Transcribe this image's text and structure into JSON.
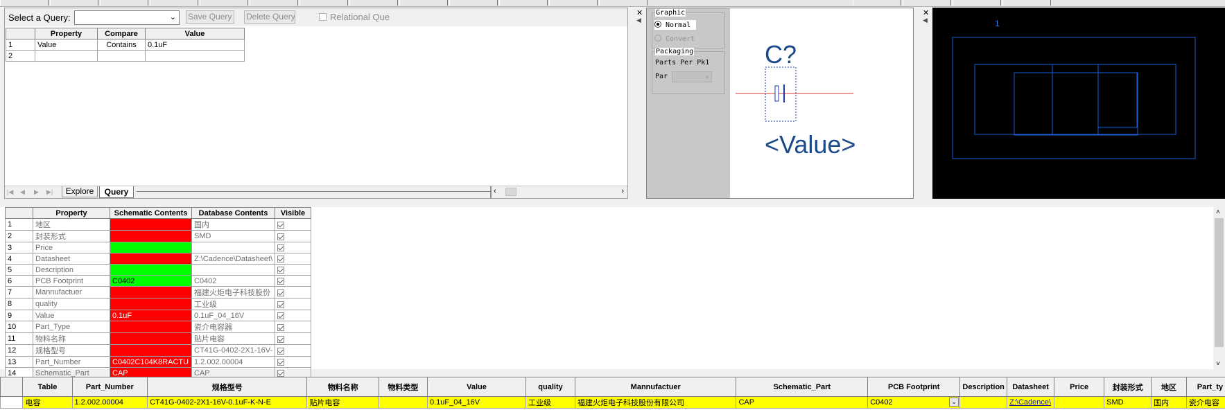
{
  "query": {
    "select_label": "Select a Query:",
    "select_value": "",
    "save_label": "Save Query",
    "delete_label": "Delete Query",
    "relational_label": "Relational Que",
    "headers": [
      "Property",
      "Compare",
      "Value"
    ],
    "rows": [
      {
        "num": "1",
        "property": "Value",
        "compare": "Contains",
        "value": "0.1uF"
      },
      {
        "num": "2",
        "property": "",
        "compare": "",
        "value": ""
      }
    ],
    "tabs": [
      "Explore",
      "Query"
    ]
  },
  "graphic": {
    "group_label": "Graphic",
    "normal_label": "Normal",
    "convert_label": "Convert",
    "packaging_label": "Packaging",
    "parts_per_pkg_label": "Parts Per Pk1",
    "part_label": "Par",
    "refdes": "C?",
    "value_text": "<Value>"
  },
  "footprint": {
    "pin_label": "1"
  },
  "compare": {
    "headers": [
      "Property",
      "Schematic Contents",
      "Database Contents",
      "Visible"
    ],
    "rows": [
      {
        "num": "1",
        "property": "地区",
        "sch": "",
        "sch_color": "red",
        "db": "国内"
      },
      {
        "num": "2",
        "property": "封装形式",
        "sch": "",
        "sch_color": "red",
        "db": "SMD"
      },
      {
        "num": "3",
        "property": "Price",
        "sch": "",
        "sch_color": "green",
        "db": ""
      },
      {
        "num": "4",
        "property": "Datasheet",
        "sch": "",
        "sch_color": "red",
        "db": "Z:\\Cadence\\Datasheet\\"
      },
      {
        "num": "5",
        "property": "Description",
        "sch": "",
        "sch_color": "green",
        "db": ""
      },
      {
        "num": "6",
        "property": "PCB Footprint",
        "sch": "C0402",
        "sch_color": "green",
        "db": "C0402"
      },
      {
        "num": "7",
        "property": "Mannufactuer",
        "sch": "",
        "sch_color": "red",
        "db": "福建火炬电子科技股份"
      },
      {
        "num": "8",
        "property": "quality",
        "sch": "",
        "sch_color": "red",
        "db": "工业级"
      },
      {
        "num": "9",
        "property": "Value",
        "sch": "0.1uF",
        "sch_color": "red",
        "db": "0.1uF_04_16V"
      },
      {
        "num": "10",
        "property": "Part_Type",
        "sch": "",
        "sch_color": "red",
        "db": "瓷介电容器"
      },
      {
        "num": "11",
        "property": "物料名称",
        "sch": "",
        "sch_color": "red",
        "db": "贴片电容"
      },
      {
        "num": "12",
        "property": "规格型号",
        "sch": "",
        "sch_color": "red",
        "db": "CT41G-0402-2X1-16V-"
      },
      {
        "num": "13",
        "property": "Part_Number",
        "sch": "C0402C104K8RACTU",
        "sch_color": "red",
        "db": "1.2.002.00004"
      },
      {
        "num": "14",
        "property": "Schematic_Part",
        "sch": "CAP",
        "sch_color": "red",
        "db": "CAP"
      }
    ]
  },
  "parts": {
    "headers": [
      "Table",
      "Part_Number",
      "规格型号",
      "物料名称",
      "物料类型",
      "Value",
      "quality",
      "Mannufactuer",
      "Schematic_Part",
      "PCB Footprint",
      "Description",
      "Datasheet",
      "Price",
      "封装形式",
      "地区",
      "Part_ty"
    ],
    "row": [
      "电容",
      "1.2.002.00004",
      "CT41G-0402-2X1-16V-0.1uF-K-N-E",
      "贴片电容",
      "",
      "0.1uF_04_16V",
      "工业级",
      "福建火炬电子科技股份有限公司",
      "CAP",
      "C0402",
      "",
      "Z:\\Cadence\\",
      "",
      "SMD",
      "国内",
      "瓷介电容"
    ]
  },
  "colors": {
    "red": "#ff0000",
    "green": "#00ff00",
    "yellow": "#ffff00",
    "footprint_line": "#1c5fd4",
    "pin": "#e03030"
  }
}
